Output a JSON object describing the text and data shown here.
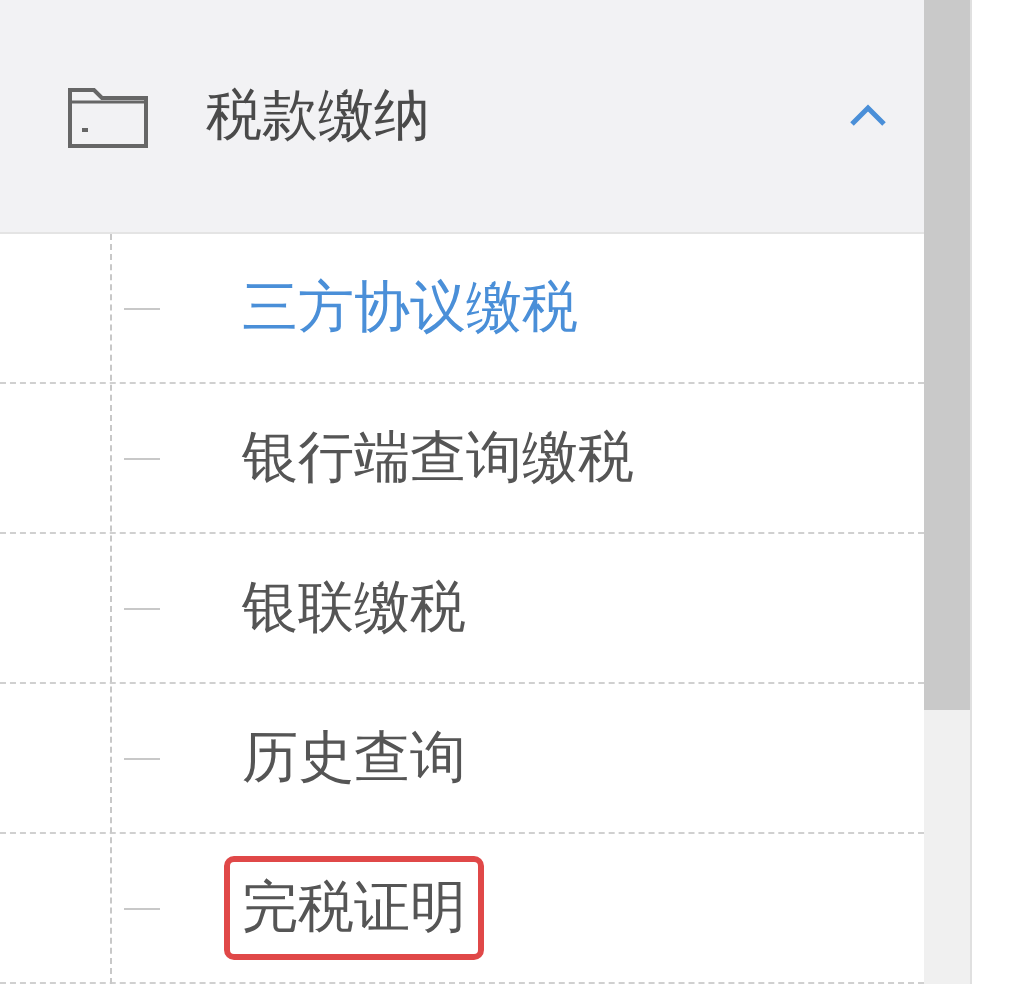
{
  "menu": {
    "title": "税款缴纳",
    "expanded": true,
    "items": [
      {
        "label": "三方协议缴税",
        "selected": true,
        "highlighted": false
      },
      {
        "label": "银行端查询缴税",
        "selected": false,
        "highlighted": false
      },
      {
        "label": "银联缴税",
        "selected": false,
        "highlighted": false
      },
      {
        "label": "历史查询",
        "selected": false,
        "highlighted": false
      },
      {
        "label": "完税证明",
        "selected": false,
        "highlighted": true
      }
    ]
  }
}
